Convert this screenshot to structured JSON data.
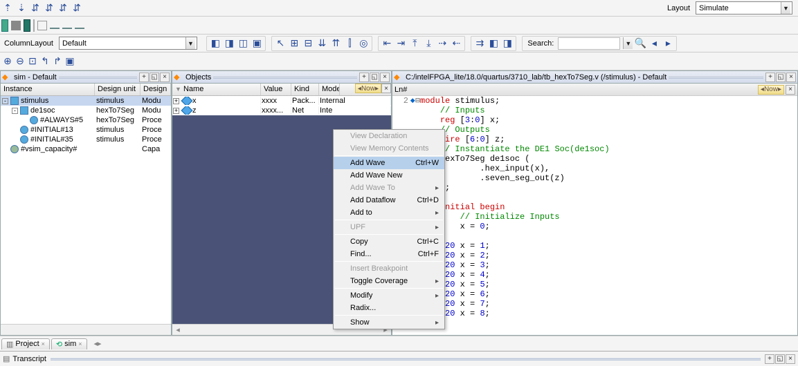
{
  "topbar": {
    "layout_label": "Layout",
    "layout_value": "Simulate"
  },
  "column_layout": {
    "label": "ColumnLayout",
    "value": "Default"
  },
  "search_label": "Search:",
  "sim_panel": {
    "title": "sim - Default",
    "columns": [
      "Instance",
      "Design unit",
      "Design"
    ],
    "rows": [
      {
        "indent": 0,
        "name": "stimulus",
        "du": "stimulus",
        "d": "Modu",
        "sel": true,
        "tw": "-"
      },
      {
        "indent": 1,
        "name": "de1soc",
        "du": "hexTo7Seg",
        "d": "Modu",
        "tw": "-"
      },
      {
        "indent": 2,
        "name": "#ALWAYS#5",
        "du": "hexTo7Seg",
        "d": "Proce",
        "tw": ""
      },
      {
        "indent": 1,
        "name": "#INITIAL#13",
        "du": "stimulus",
        "d": "Proce",
        "tw": ""
      },
      {
        "indent": 1,
        "name": "#INITIAL#35",
        "du": "stimulus",
        "d": "Proce",
        "tw": ""
      },
      {
        "indent": 0,
        "name": "#vsim_capacity#",
        "du": "",
        "d": "Capa",
        "tw": ""
      }
    ],
    "bottom_tabs": [
      "Project",
      "sim"
    ]
  },
  "objects_panel": {
    "title": "Objects",
    "columns": [
      "Name",
      "Value",
      "Kind",
      "Mode"
    ],
    "now_label": "Now",
    "rows": [
      {
        "name": "x",
        "value": "xxxx",
        "kind": "Pack...",
        "mode": "Internal"
      },
      {
        "name": "z",
        "value": "xxxx...",
        "kind": "Net",
        "mode": "Inte"
      }
    ]
  },
  "context_menu": {
    "items": [
      {
        "label": "View Declaration",
        "disabled": true
      },
      {
        "label": "View Memory Contents",
        "disabled": true
      },
      {
        "sep": true
      },
      {
        "label": "Add Wave",
        "accel": "Ctrl+W",
        "selected": true
      },
      {
        "label": "Add Wave New"
      },
      {
        "label": "Add Wave To",
        "sub": true,
        "disabled": true
      },
      {
        "label": "Add Dataflow",
        "accel": "Ctrl+D"
      },
      {
        "label": "Add to",
        "sub": true
      },
      {
        "sep": true
      },
      {
        "label": "UPF",
        "sub": true,
        "disabled": true
      },
      {
        "sep": true
      },
      {
        "label": "Copy",
        "accel": "Ctrl+C"
      },
      {
        "label": "Find...",
        "accel": "Ctrl+F"
      },
      {
        "sep": true
      },
      {
        "label": "Insert Breakpoint",
        "disabled": true
      },
      {
        "label": "Toggle Coverage",
        "sub": true
      },
      {
        "sep": true
      },
      {
        "label": "Modify",
        "sub": true
      },
      {
        "label": "Radix..."
      },
      {
        "sep": true
      },
      {
        "label": "Show",
        "sub": true
      }
    ]
  },
  "source_panel": {
    "title": "C:/intelFPGA_lite/18.0/quartus/3710_lab/tb_hexTo7Seg.v (/stimulus) - Default",
    "ln_label": "Ln#",
    "now_label": "Now",
    "first_line_no": "2",
    "lines": [
      [
        {
          "c": "kw-red",
          "t": "module"
        },
        {
          "c": "txt",
          "t": " stimulus;"
        }
      ],
      [
        {
          "c": "txt",
          "t": "    "
        },
        {
          "c": "kw-green",
          "t": "// Inputs"
        }
      ],
      [
        {
          "c": "txt",
          "t": "    "
        },
        {
          "c": "kw-red",
          "t": "reg"
        },
        {
          "c": "txt",
          "t": " ["
        },
        {
          "c": "kw-blue",
          "t": "3"
        },
        {
          "c": "txt",
          "t": ":"
        },
        {
          "c": "kw-blue",
          "t": "0"
        },
        {
          "c": "txt",
          "t": "] x;"
        }
      ],
      [
        {
          "c": "txt",
          "t": "    "
        },
        {
          "c": "kw-green",
          "t": "// Outputs"
        }
      ],
      [
        {
          "c": "txt",
          "t": "    "
        },
        {
          "c": "kw-red",
          "t": "wire"
        },
        {
          "c": "txt",
          "t": " ["
        },
        {
          "c": "kw-blue",
          "t": "6"
        },
        {
          "c": "txt",
          "t": ":"
        },
        {
          "c": "kw-blue",
          "t": "0"
        },
        {
          "c": "txt",
          "t": "] z;"
        }
      ],
      [
        {
          "c": "txt",
          "t": "    "
        },
        {
          "c": "kw-green",
          "t": "// Instantiate the DE1 Soc(de1soc)"
        }
      ],
      [
        {
          "c": "txt",
          "t": "    hexTo7Seg de1soc ("
        }
      ],
      [
        {
          "c": "txt",
          "t": "            .hex_input(x),"
        }
      ],
      [
        {
          "c": "txt",
          "t": "            .seven_seg_out(z)"
        }
      ],
      [
        {
          "c": "txt",
          "t": "    );"
        }
      ],
      [
        {
          "c": "txt",
          "t": ""
        }
      ],
      [
        {
          "c": "txt",
          "t": "    "
        },
        {
          "c": "kw-red",
          "t": "initial"
        },
        {
          "c": "kw-red",
          "t": " begin"
        }
      ],
      [
        {
          "c": "txt",
          "t": "        "
        },
        {
          "c": "kw-green",
          "t": "// Initialize Inputs"
        }
      ],
      [
        {
          "c": "txt",
          "t": "        x = "
        },
        {
          "c": "kw-blue",
          "t": "0"
        },
        {
          "c": "txt",
          "t": ";"
        }
      ],
      [
        {
          "c": "txt",
          "t": ""
        }
      ],
      [
        {
          "c": "txt",
          "t": "    "
        },
        {
          "c": "kw-purple",
          "t": "#"
        },
        {
          "c": "kw-blue",
          "t": "20"
        },
        {
          "c": "txt",
          "t": " x = "
        },
        {
          "c": "kw-blue",
          "t": "1"
        },
        {
          "c": "txt",
          "t": ";"
        }
      ],
      [
        {
          "c": "txt",
          "t": "    "
        },
        {
          "c": "kw-purple",
          "t": "#"
        },
        {
          "c": "kw-blue",
          "t": "20"
        },
        {
          "c": "txt",
          "t": " x = "
        },
        {
          "c": "kw-blue",
          "t": "2"
        },
        {
          "c": "txt",
          "t": ";"
        }
      ],
      [
        {
          "c": "txt",
          "t": "    "
        },
        {
          "c": "kw-purple",
          "t": "#"
        },
        {
          "c": "kw-blue",
          "t": "20"
        },
        {
          "c": "txt",
          "t": " x = "
        },
        {
          "c": "kw-blue",
          "t": "3"
        },
        {
          "c": "txt",
          "t": ";"
        }
      ],
      [
        {
          "c": "txt",
          "t": "    "
        },
        {
          "c": "kw-purple",
          "t": "#"
        },
        {
          "c": "kw-blue",
          "t": "20"
        },
        {
          "c": "txt",
          "t": " x = "
        },
        {
          "c": "kw-blue",
          "t": "4"
        },
        {
          "c": "txt",
          "t": ";"
        }
      ],
      [
        {
          "c": "txt",
          "t": "    "
        },
        {
          "c": "kw-purple",
          "t": "#"
        },
        {
          "c": "kw-blue",
          "t": "20"
        },
        {
          "c": "txt",
          "t": " x = "
        },
        {
          "c": "kw-blue",
          "t": "5"
        },
        {
          "c": "txt",
          "t": ";"
        }
      ],
      [
        {
          "c": "txt",
          "t": "    "
        },
        {
          "c": "kw-purple",
          "t": "#"
        },
        {
          "c": "kw-blue",
          "t": "20"
        },
        {
          "c": "txt",
          "t": " x = "
        },
        {
          "c": "kw-blue",
          "t": "6"
        },
        {
          "c": "txt",
          "t": ";"
        }
      ],
      [
        {
          "c": "txt",
          "t": "    "
        },
        {
          "c": "kw-purple",
          "t": "#"
        },
        {
          "c": "kw-blue",
          "t": "20"
        },
        {
          "c": "txt",
          "t": " x = "
        },
        {
          "c": "kw-blue",
          "t": "7"
        },
        {
          "c": "txt",
          "t": ";"
        }
      ],
      [
        {
          "c": "txt",
          "t": "    "
        },
        {
          "c": "kw-purple",
          "t": "#"
        },
        {
          "c": "kw-blue",
          "t": "20"
        },
        {
          "c": "txt",
          "t": " x = "
        },
        {
          "c": "kw-blue",
          "t": "8"
        },
        {
          "c": "txt",
          "t": ";"
        }
      ]
    ]
  },
  "transcript": {
    "title": "Transcript"
  }
}
